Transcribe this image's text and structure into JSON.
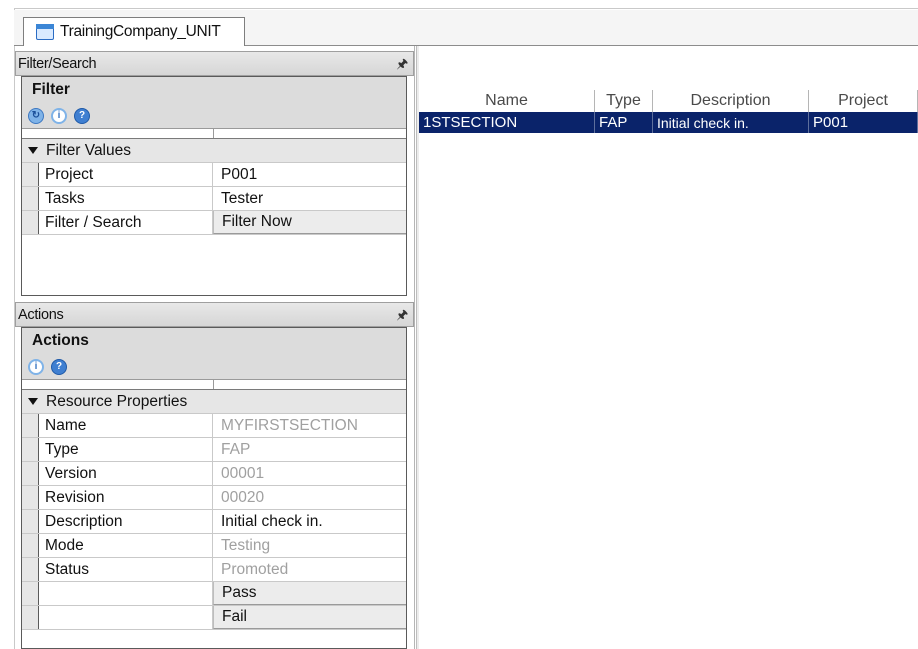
{
  "document_tab": {
    "label": "TrainingCompany_UNIT"
  },
  "filter_pane": {
    "header": "Filter/Search",
    "title": "Filter",
    "group": "Filter Values",
    "rows": [
      {
        "name": "Project",
        "value": "P001"
      },
      {
        "name": "Tasks",
        "value": "Tester"
      },
      {
        "name": "Filter / Search",
        "value": "Filter Now"
      }
    ]
  },
  "actions_pane": {
    "header": "Actions",
    "title": "Actions",
    "group": "Resource Properties",
    "rows": [
      {
        "name": "Name",
        "value": "MYFIRSTSECTION"
      },
      {
        "name": "Type",
        "value": "FAP"
      },
      {
        "name": "Version",
        "value": "00001"
      },
      {
        "name": "Revision",
        "value": "00020"
      },
      {
        "name": "Description",
        "value": "Initial check in."
      },
      {
        "name": "Mode",
        "value": "Testing"
      },
      {
        "name": "Status",
        "value": "Promoted"
      },
      {
        "name": "",
        "value": "Pass"
      },
      {
        "name": "",
        "value": "Fail"
      }
    ]
  },
  "grid": {
    "columns": [
      "Name",
      "Type",
      "Description",
      "Project"
    ],
    "rows": [
      [
        "1STSECTION",
        "FAP",
        "Initial check in.",
        "P001"
      ]
    ]
  },
  "icons": {
    "tab": "document-window-icon",
    "pin": "pin-icon",
    "refresh": "refresh-icon",
    "info": "info-icon",
    "help": "help-icon"
  },
  "colors": {
    "selection": "#0a236a",
    "header_bg": "#dcdcdc",
    "read_only_text": "#a0a0a0"
  }
}
